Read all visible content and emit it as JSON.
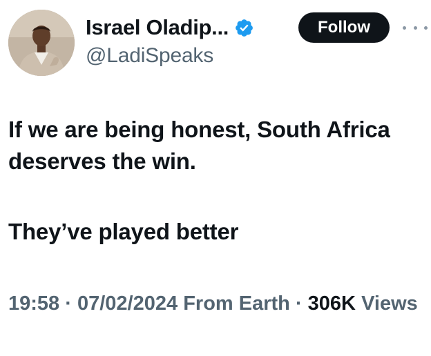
{
  "author": {
    "display_name": "Israel Oladip...",
    "handle": "@LadiSpeaks",
    "verified": true,
    "verified_color": "#1d9bf0"
  },
  "actions": {
    "follow_label": "Follow",
    "more_icon": "more-horizontal-icon"
  },
  "tweet": {
    "lines": [
      "If we are being honest, South Africa deserves the win.",
      "They’ve played better"
    ]
  },
  "meta": {
    "time": "19:58",
    "separator": "·",
    "date": "07/02/2024",
    "source": "From Earth",
    "views_count": "306K",
    "views_label": "Views"
  },
  "colors": {
    "text": "#0f1419",
    "secondary": "#536471",
    "button_bg": "#0f1419"
  }
}
